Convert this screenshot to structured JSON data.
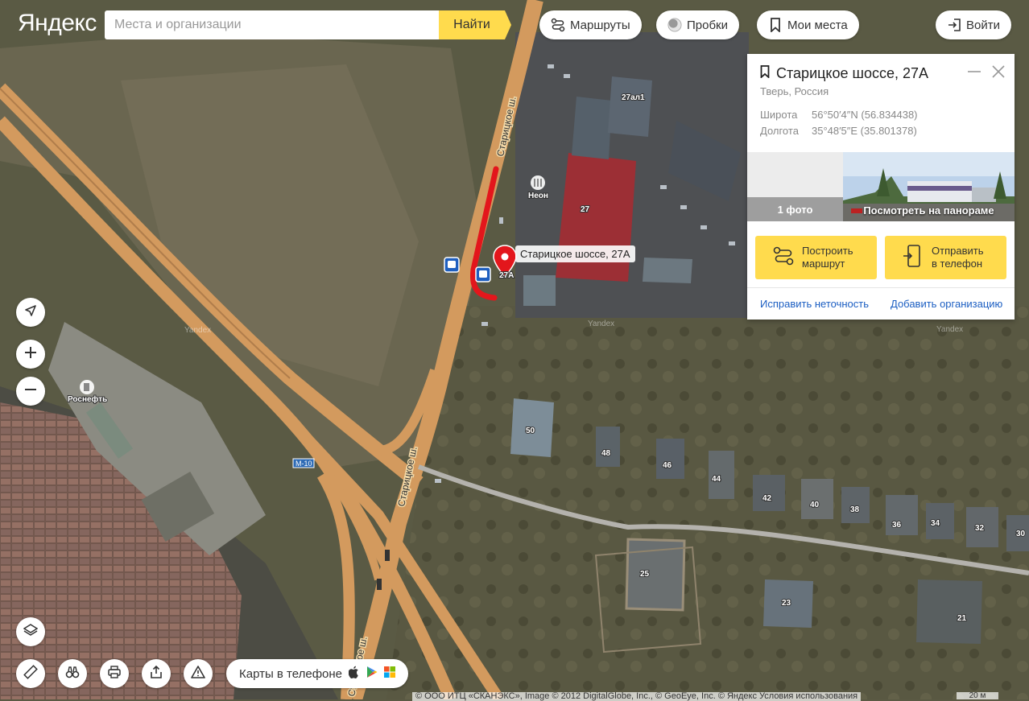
{
  "brand": {
    "logo": "Яндекс"
  },
  "search": {
    "placeholder": "Места и организации",
    "value": "",
    "button": "Найти"
  },
  "toolbar": {
    "routes": "Маршруты",
    "traffic": "Пробки",
    "my_places": "Мои места",
    "login": "Войти"
  },
  "card": {
    "title": "Старицкое шоссе, 27А",
    "subtitle": "Тверь, Россия",
    "latitude_label": "Широта",
    "latitude_value": "56°50′4″N (56.834438)",
    "longitude_label": "Долгота",
    "longitude_value": "35°48′5″E (35.801378)",
    "photo_count": "1 фото",
    "panorama": "Посмотреть на панораме",
    "route_button": [
      "Построить",
      "маршрут"
    ],
    "send_button": [
      "Отправить",
      "в телефон"
    ],
    "fix_link": "Исправить неточность",
    "add_org_link": "Добавить организацию"
  },
  "map": {
    "pin_label": "Старицкое шоссе, 27А",
    "street_name": "Старицкое ш.",
    "highway": "М-10",
    "poi_neon": "Неон",
    "poi_rosneft": "Роснефть",
    "pin_house": "27А",
    "watermark": "Yandex",
    "house_numbers": [
      "27ал1",
      "27",
      "50",
      "48",
      "46",
      "44",
      "42",
      "40",
      "38",
      "36",
      "34",
      "32",
      "30",
      "25",
      "23",
      "21"
    ]
  },
  "bottom": {
    "apps_label": "Карты в телефоне",
    "copyright": "© ООО ИТЦ «СКАНЭКС», Image © 2012 DigitalGlobe, Inc., © GeoEye, Inc. © Яндекс Условия использования",
    "scale": "20 м"
  }
}
